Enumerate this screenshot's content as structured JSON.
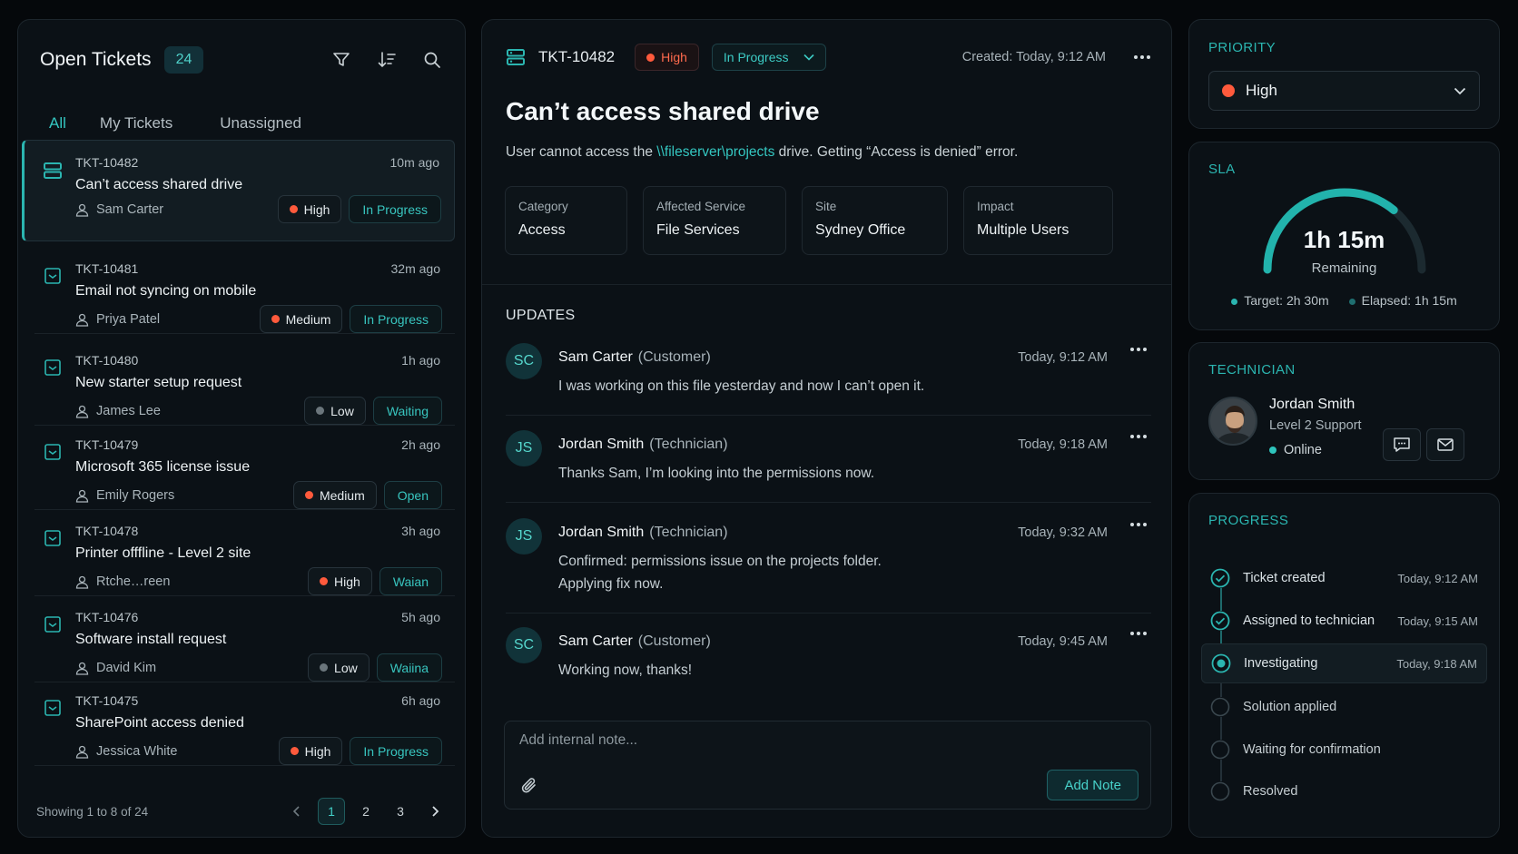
{
  "colors": {
    "accent": "#2bb5b0",
    "high": "#ff5a3c",
    "medium": "#ff5a3c",
    "low": "#6b767c"
  },
  "left": {
    "title": "Open Tickets",
    "count": "24",
    "tabs": [
      {
        "label": "All"
      },
      {
        "label": "My Tickets"
      },
      {
        "label": "Unassigned"
      }
    ],
    "tickets": [
      {
        "id": "TKT-10482",
        "time": "10m ago",
        "title": "Can’t access shared drive",
        "user": "Sam Carter",
        "priority": "High",
        "status": "In Progress"
      },
      {
        "id": "TKT-10481",
        "time": "32m ago",
        "title": "Email not syncing on mobile",
        "user": "Priya Patel",
        "priority": "Medium",
        "status": "In Progress"
      },
      {
        "id": "TKT-10480",
        "time": "1h ago",
        "title": "New starter setup request",
        "user": "James Lee",
        "priority": "Low",
        "status": "Waiting"
      },
      {
        "id": "TKT-10479",
        "time": "2h ago",
        "title": "Microsoft 365 license issue",
        "user": "Emily Rogers",
        "priority": "Medium",
        "status": "Open"
      },
      {
        "id": "TKT-10478",
        "time": "3h ago",
        "title": "Printer offfline - Level 2 site",
        "user": "Rtche…reen",
        "priority": "High",
        "status": "Waian"
      },
      {
        "id": "TKT-10476",
        "time": "5h ago",
        "title": "Software install request",
        "user": "David Kim",
        "priority": "Low",
        "status": "Waiina"
      },
      {
        "id": "TKT-10475",
        "time": "6h ago",
        "title": "SharePoint access denied",
        "user": "Jessica White",
        "priority": "High",
        "status": "In Progress"
      }
    ],
    "footer": {
      "showing": "Showing 1 to 8 of 24",
      "pages": [
        "1",
        "2",
        "3"
      ],
      "current_page": "1"
    }
  },
  "detail": {
    "id": "TKT-10482",
    "priority": "High",
    "status": "In Progress",
    "created": "Created: Today, 9:12 AM",
    "title": "Can’t access shared drive",
    "desc_pre": "User cannot access the ",
    "desc_link": "\\\\fileserver\\projects",
    "desc_post": " drive. Getting “Access is denied” error.",
    "facts": [
      {
        "label": "Category",
        "value": "Access"
      },
      {
        "label": "Affected Service",
        "value": "File Services"
      },
      {
        "label": "Site",
        "value": "Sydney Office"
      },
      {
        "label": "Impact",
        "value": "Multiple Users"
      }
    ],
    "updates_header": "UPDATES",
    "updates": [
      {
        "initials": "SC",
        "name": "Sam Carter",
        "role": "(Customer)",
        "time": "Today, 9:12 AM",
        "lines": [
          "I was working on this file yesterday and now I can’t open it."
        ]
      },
      {
        "initials": "JS",
        "name": "Jordan Smith",
        "role": "(Technician)",
        "time": "Today, 9:18 AM",
        "lines": [
          "Thanks Sam, I’m looking into the permissions now."
        ]
      },
      {
        "initials": "JS",
        "name": "Jordan Smith",
        "role": "(Technician)",
        "time": "Today, 9:32 AM",
        "lines": [
          "Confirmed: permissions issue on the projects folder.",
          "Applying fix now."
        ]
      },
      {
        "initials": "SC",
        "name": "Sam Carter",
        "role": "(Customer)",
        "time": "Today, 9:45 AM",
        "lines": [
          "Working now, thanks!"
        ]
      }
    ],
    "note_placeholder": "Add internal note...",
    "add_note_label": "Add Note"
  },
  "priority_panel": {
    "title": "PRIORITY",
    "value": "High"
  },
  "sla": {
    "title": "SLA",
    "remaining": "1h 15m",
    "remaining_label": "Remaining",
    "target": "Target: 2h 30m",
    "elapsed": "Elapsed: 1h 15m",
    "progress_fraction": 0.72
  },
  "technician": {
    "title": "TECHNICIAN",
    "name": "Jordan Smith",
    "level": "Level 2 Support",
    "status": "Online"
  },
  "progress": {
    "title": "PROGRESS",
    "steps": [
      {
        "label": "Ticket created",
        "time": "Today, 9:12 AM",
        "state": "done"
      },
      {
        "label": "Assigned to technician",
        "time": "Today, 9:15 AM",
        "state": "done"
      },
      {
        "label": "Investigating",
        "time": "Today, 9:18 AM",
        "state": "current"
      },
      {
        "label": "Solution applied",
        "time": "",
        "state": "pending"
      },
      {
        "label": "Waiting for confirmation",
        "time": "",
        "state": "pending"
      },
      {
        "label": "Resolved",
        "time": "",
        "state": "pending"
      }
    ]
  }
}
